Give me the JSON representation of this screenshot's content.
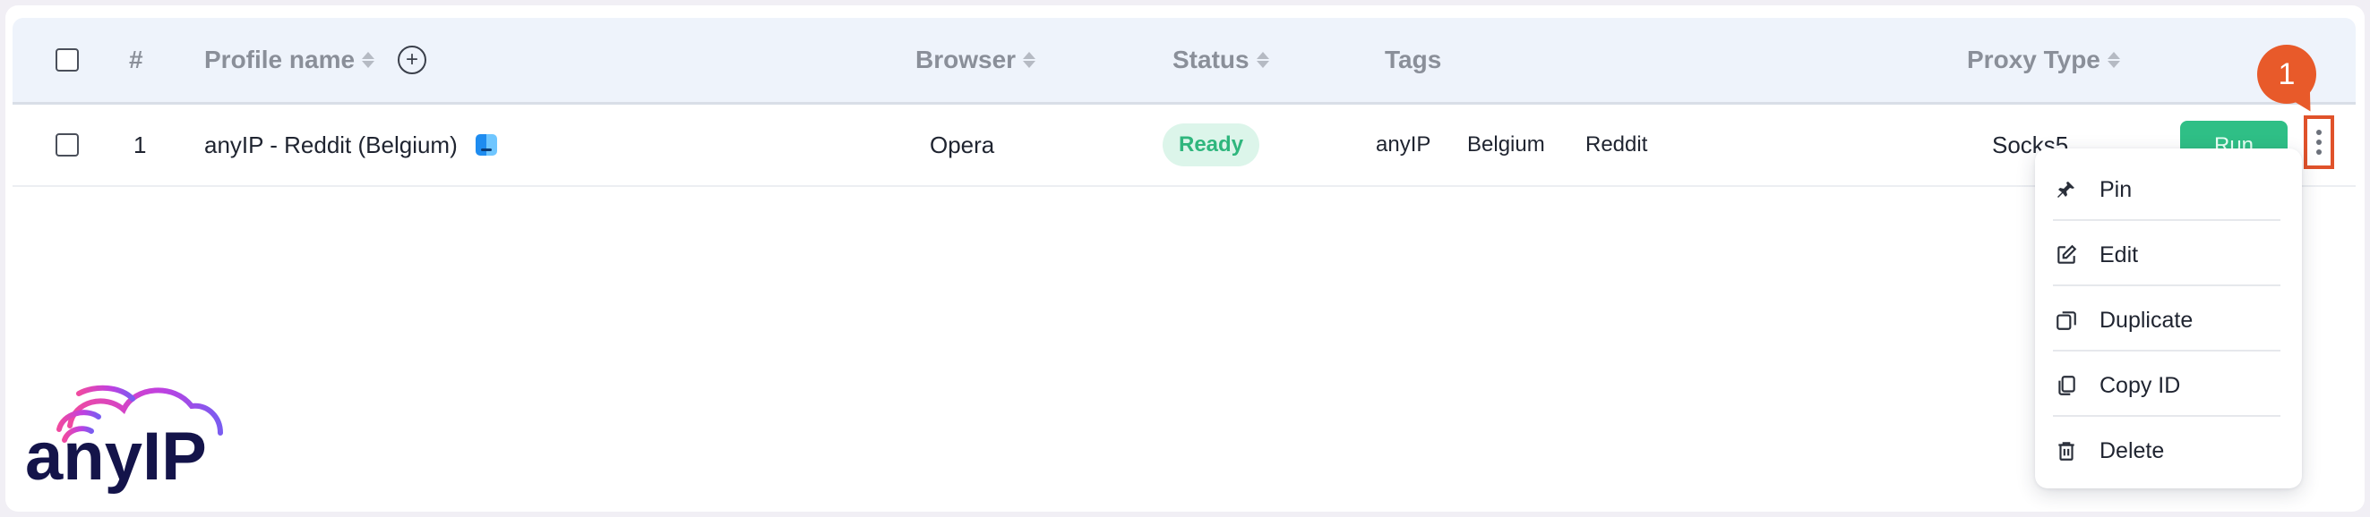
{
  "table": {
    "header": {
      "number": "#",
      "profile_name": "Profile name",
      "browser": "Browser",
      "status": "Status",
      "tags": "Tags",
      "proxy_type": "Proxy Type",
      "add_column_icon": "plus-circle-icon",
      "sort_icon": "sort-arrows-icon"
    },
    "rows": [
      {
        "number": "1",
        "profile_name": "anyIP - Reddit (Belgium)",
        "os_icon": "finder-icon",
        "browser": "Opera",
        "status": "Ready",
        "tags": [
          "anyIP",
          "Belgium",
          "Reddit"
        ],
        "proxy_type": "Socks5",
        "run_label": "Run"
      }
    ]
  },
  "annotation": {
    "callout_number": "1"
  },
  "context_menu": {
    "items": [
      {
        "label": "Pin",
        "icon": "pin-icon"
      },
      {
        "label": "Edit",
        "icon": "edit-icon"
      },
      {
        "label": "Duplicate",
        "icon": "duplicate-icon"
      },
      {
        "label": "Copy ID",
        "icon": "copy-icon"
      },
      {
        "label": "Delete",
        "icon": "trash-icon"
      }
    ]
  },
  "brand": {
    "logo_text": "anyIP"
  },
  "colors": {
    "accent_green": "#2fbf86",
    "status_ready_bg": "#dcf5ea",
    "status_ready_text": "#2fb67d",
    "callout_orange": "#e85a2a",
    "logo_navy": "#14144a",
    "logo_magenta": "#e040c0"
  }
}
